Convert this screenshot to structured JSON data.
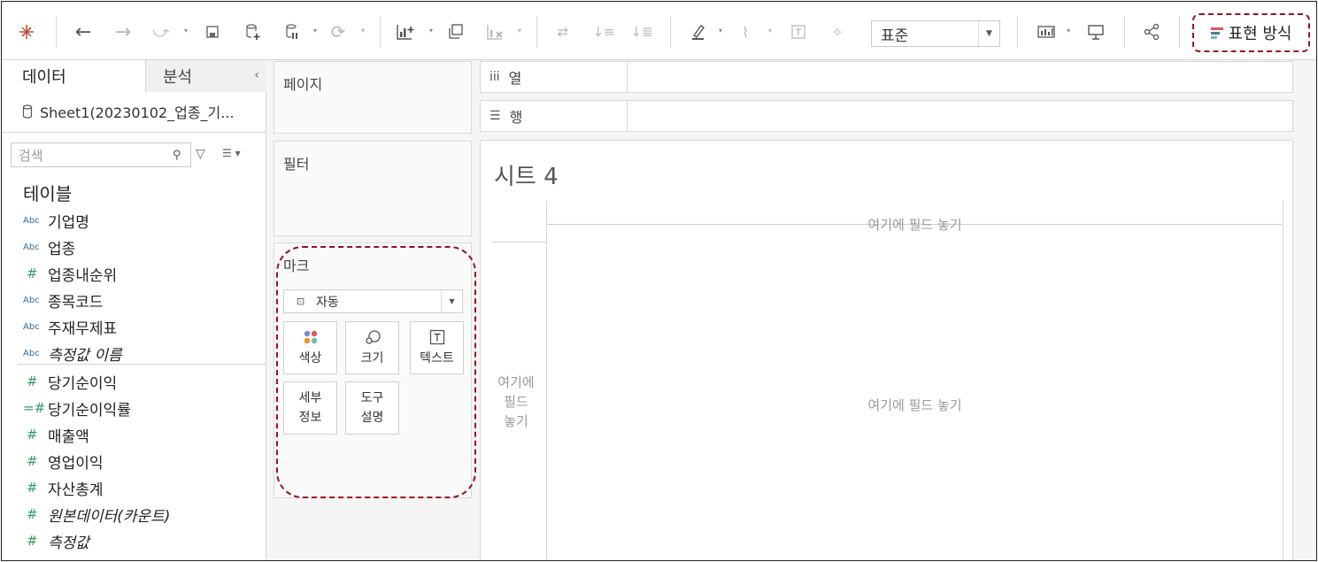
{
  "toolbar": {
    "style_select": {
      "value": "표준"
    },
    "show_me": {
      "label": "표현 방식",
      "bar_colors": [
        "#e15759",
        "#4e79a7",
        "#76b7b2"
      ]
    }
  },
  "data_pane": {
    "tabs": {
      "data": "데이터",
      "analytics": "분석"
    },
    "source": "Sheet1(20230102_업종_기...",
    "search_placeholder": "검색",
    "section_title": "테이블",
    "fields": [
      {
        "type": "Abc",
        "name": "기업명",
        "italic": false
      },
      {
        "type": "Abc",
        "name": "업종",
        "italic": false
      },
      {
        "type": "#",
        "name": "업종내순위",
        "italic": false
      },
      {
        "type": "Abc",
        "name": "종목코드",
        "italic": false
      },
      {
        "type": "Abc",
        "name": "주재무제표",
        "italic": false
      },
      {
        "type": "Abc",
        "name": "측정값 이름",
        "italic": true
      },
      {
        "type": "#",
        "name": "당기순이익",
        "italic": false
      },
      {
        "type": "=#",
        "name": "당기순이익률",
        "italic": false
      },
      {
        "type": "#",
        "name": "매출액",
        "italic": false
      },
      {
        "type": "#",
        "name": "영업이익",
        "italic": false
      },
      {
        "type": "#",
        "name": "자산총계",
        "italic": false
      },
      {
        "type": "#",
        "name": "원본데이터(카운트)",
        "italic": true
      },
      {
        "type": "#",
        "name": "측정값",
        "italic": true
      }
    ]
  },
  "cards": {
    "pages": "페이지",
    "filters": "필터",
    "marks": {
      "title": "마크",
      "mark_type": "자동",
      "buttons": {
        "color": "색상",
        "size": "크기",
        "text": "텍스트",
        "detail_1": "세부",
        "detail_2": "정보",
        "tooltip_1": "도구",
        "tooltip_2": "설명"
      }
    }
  },
  "shelves": {
    "columns": "열",
    "rows": "행"
  },
  "sheet": {
    "title": "시트 4",
    "drop_col": "여기에 필드 놓기",
    "drop_row_1": "여기에",
    "drop_row_2": "필드",
    "drop_row_3": "놓기",
    "drop_main": "여기에 필드 놓기"
  }
}
